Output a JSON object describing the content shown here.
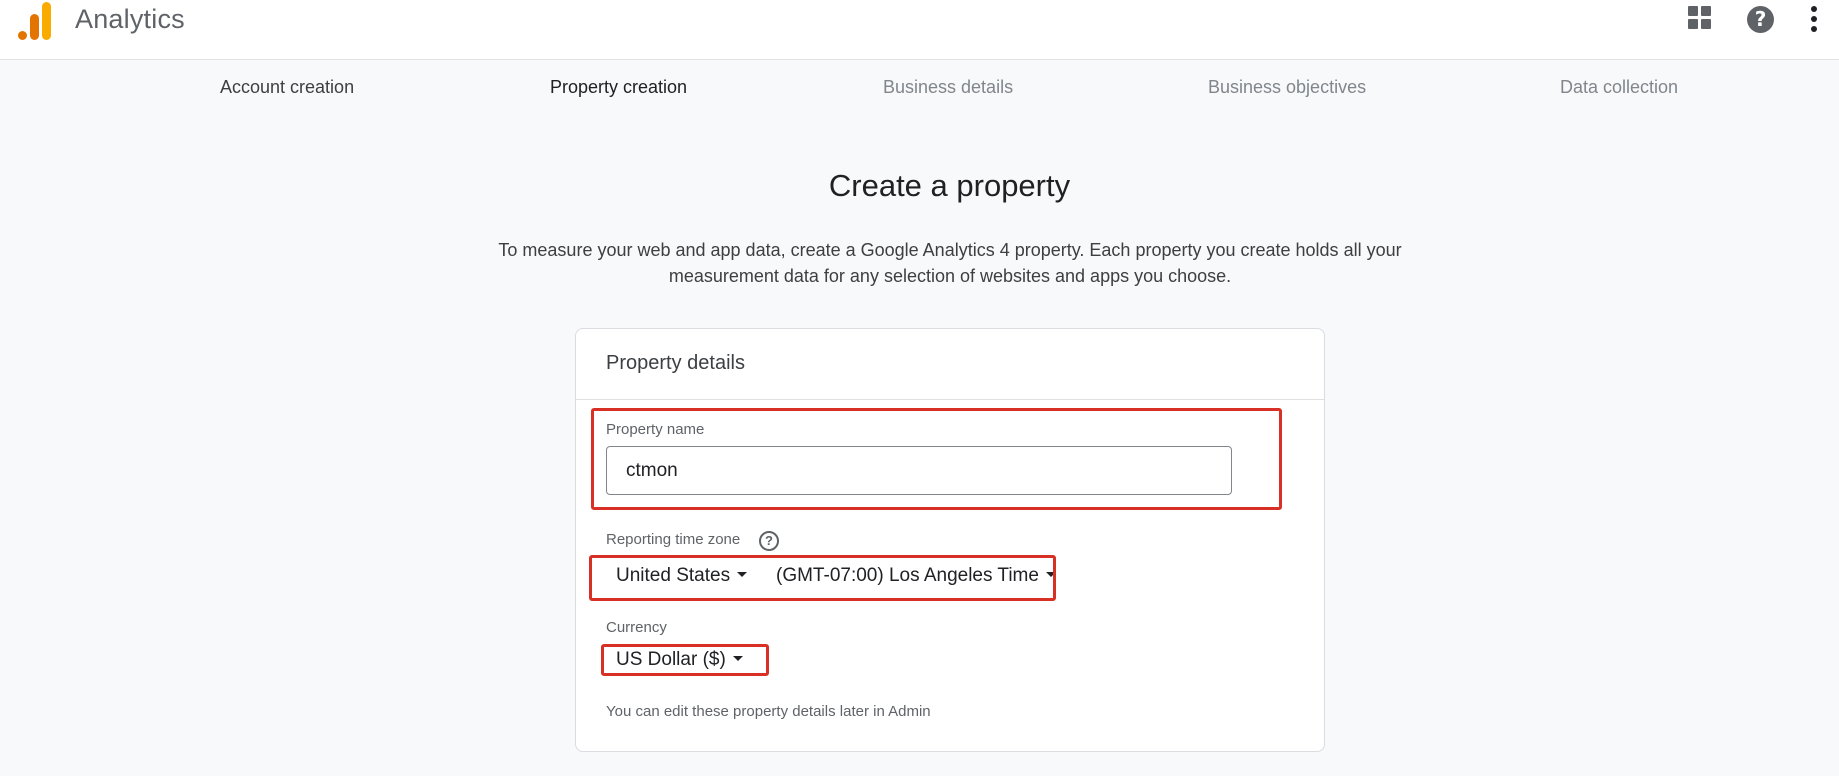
{
  "header": {
    "app_title": "Analytics",
    "icons": [
      "apps-icon",
      "help-icon",
      "more-vert-icon"
    ],
    "help_glyph": "?"
  },
  "stepper": {
    "steps": [
      {
        "label": "Account creation",
        "state": "done"
      },
      {
        "label": "Property creation",
        "state": "active"
      },
      {
        "label": "Business details",
        "state": "upcoming"
      },
      {
        "label": "Business objectives",
        "state": "upcoming"
      },
      {
        "label": "Data collection",
        "state": "upcoming"
      }
    ]
  },
  "main": {
    "title": "Create a property",
    "description": "To measure your web and app data, create a Google Analytics 4 property. Each property you create holds all your measurement data for any selection of websites and apps you choose."
  },
  "card": {
    "title": "Property details",
    "property_name_label": "Property name",
    "property_name_value": "ctmon",
    "time_zone_label": "Reporting time zone",
    "country_value": "United States",
    "time_zone_value": "(GMT-07:00) Los Angeles Time",
    "currency_label": "Currency",
    "currency_value": "US Dollar ($)",
    "hint": "You can edit these property details later in Admin"
  },
  "colors": {
    "highlight": "#d93025",
    "logo_orange": "#e37400",
    "logo_yellow": "#f9ab00"
  }
}
